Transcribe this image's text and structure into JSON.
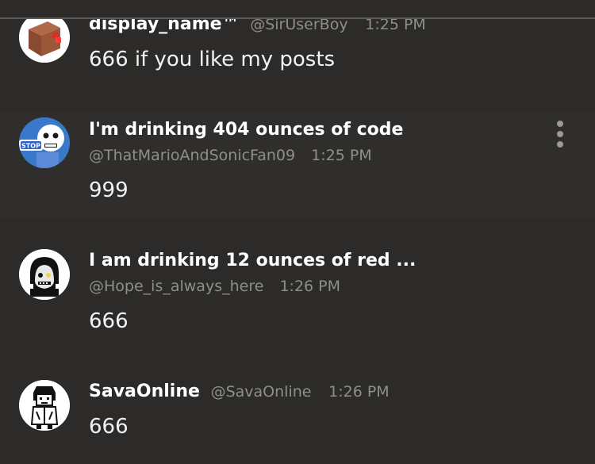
{
  "posts": [
    {
      "name": "display_name™",
      "handle": "@SirUserBoy",
      "time": "1:25 PM",
      "body": "666 if you like my posts",
      "avatar_icon": "box-icon"
    },
    {
      "name": "I'm drinking 404 ounces of code",
      "handle": "@ThatMarioAndSonicFan09",
      "time": "1:25 PM",
      "body": "999",
      "avatar_icon": "stop-sign-skeleton-icon",
      "avatar_text": "STOP"
    },
    {
      "name": "I am drinking 12 ounces of red ...",
      "handle": "@Hope_is_always_here",
      "time": "1:26 PM",
      "body": "666",
      "avatar_icon": "hooded-skeleton-icon"
    },
    {
      "name": "SavaOnline",
      "handle": "@SavaOnline",
      "time": "1:26 PM",
      "body": "666",
      "avatar_icon": "pixel-character-icon"
    }
  ],
  "colors": {
    "background": "#2c2b29",
    "secondary_text": "#8f8e8c",
    "primary_text": "#ffffff"
  },
  "more_menu_icon": "more-vertical-icon"
}
